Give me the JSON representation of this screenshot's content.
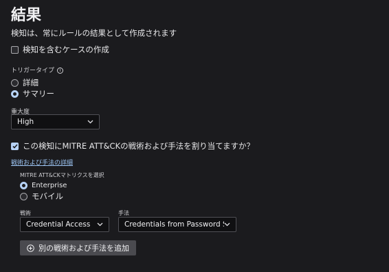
{
  "title": "結果",
  "description": "検知は、常にルールの結果として作成されます",
  "create_case": {
    "label": "検知を含むケースの作成",
    "checked": false
  },
  "trigger_type": {
    "label": "トリガータイプ",
    "options": [
      {
        "label": "詳細",
        "selected": false
      },
      {
        "label": "サマリー",
        "selected": true
      }
    ]
  },
  "severity": {
    "label": "重大度",
    "value": "High"
  },
  "mitre": {
    "question": "この検知にMITRE ATT&CKの戦術および手法を割り当てますか？",
    "checked": true,
    "details_link": "戦術および手法の詳細",
    "matrix_label": "MITRE ATT&CKマトリクスを選択",
    "matrix_options": [
      {
        "label": "Enterprise",
        "selected": true
      },
      {
        "label": "モバイル",
        "selected": false
      }
    ],
    "tactic_label": "戦術",
    "tactic_value": "Credential Access",
    "technique_label": "手法",
    "technique_value": "Credentials from Password Stores",
    "add_button": "別の戦術および手法を追加"
  },
  "colors": {
    "background": "#1b1b1e",
    "accent": "#b7d3f7",
    "link": "#9cc4f3"
  }
}
